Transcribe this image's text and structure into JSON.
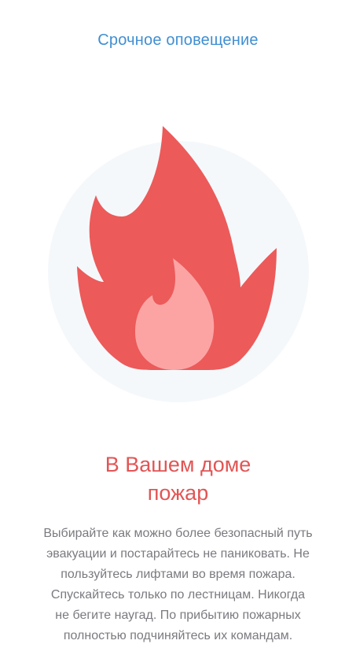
{
  "header": {
    "title": "Срочное оповещение"
  },
  "illustration": {
    "icon": "fire-icon",
    "circle_color": "#f5f8fb",
    "flame_outer_color": "#ec5a5a",
    "flame_inner_color": "#fca4a4"
  },
  "alert": {
    "title_line1": "В Вашем доме",
    "title_line2": "пожар",
    "title_color": "#e25555",
    "body_lines": [
      "Выбирайте как можно более безопасный путь",
      "эвакуации и постарайтесь не паниковать. Не",
      "пользуйтесь лифтами во время пожара.",
      "Спускайтесь только по лестницам. Никогда",
      "не бегите наугад. По прибытию пожарных",
      "полностью подчиняйтесь их командам."
    ]
  },
  "colors": {
    "accent": "#3f8fd2",
    "text_muted": "#7a7a80"
  }
}
